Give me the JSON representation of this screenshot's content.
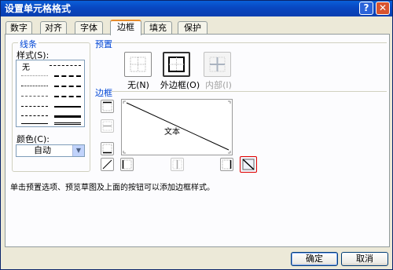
{
  "window": {
    "title": "设置单元格格式",
    "help_label": "?",
    "close_label": "✕"
  },
  "tabs": [
    {
      "label": "数字"
    },
    {
      "label": "对齐"
    },
    {
      "label": "字体"
    },
    {
      "label": "边框",
      "active": true
    },
    {
      "label": "填充"
    },
    {
      "label": "保护"
    }
  ],
  "line": {
    "group_label": "线条",
    "style_label": "样式(S):",
    "none_label": "无",
    "color_label": "颜色(C):",
    "color_value": "自动",
    "color_arrow_icon": "chevron-down-icon"
  },
  "presets": {
    "group_label": "预置",
    "items": [
      {
        "label": "无(N)",
        "icon": "border-none-icon"
      },
      {
        "label": "外边框(O)",
        "icon": "border-outline-icon",
        "selected": true
      },
      {
        "label": "内部(I)",
        "icon": "border-inside-icon",
        "disabled": true
      }
    ]
  },
  "border": {
    "group_label": "边框",
    "preview_text": "文本",
    "diagonal_down_active": true
  },
  "hint": "单击预置选项、预览草图及上面的按钮可以添加边框样式。",
  "buttons": {
    "ok": "确定",
    "cancel": "取消"
  },
  "colors": {
    "accent": "#e68b2c",
    "group_title": "#0046d5",
    "titlebar": "#0a46c0",
    "highlight": "#e00000"
  }
}
